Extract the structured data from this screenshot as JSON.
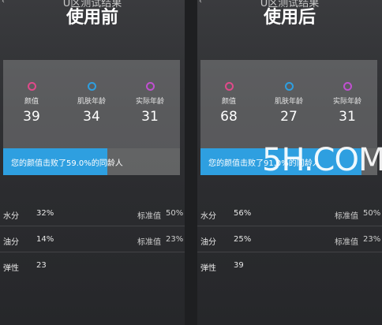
{
  "watermark": "5H.COM",
  "colors": {
    "ring_face": "#e04a8a",
    "ring_skin": "#2e9fe0",
    "ring_real": "#c050d0",
    "bar_fill": "#2e9fe0"
  },
  "panels": [
    {
      "subtitle": "U区测试结果",
      "title": "使用前",
      "metrics": [
        {
          "label": "颜值",
          "value": "39",
          "icon": "circle-pink-icon"
        },
        {
          "label": "肌肤年龄",
          "value": "34",
          "icon": "circle-blue-icon"
        },
        {
          "label": "实际年龄",
          "value": "31",
          "icon": "circle-purple-icon"
        }
      ],
      "bar_text": "您的颜值击败了59.0%的同龄人",
      "bar_percent": 59,
      "rows": [
        {
          "key": "水分",
          "value": "32%",
          "std_label": "标准值",
          "std_value": "50%"
        },
        {
          "key": "油分",
          "value": "14%",
          "std_label": "标准值",
          "std_value": "23%"
        },
        {
          "key": "弹性",
          "value": "23",
          "std_label": "",
          "std_value": ""
        }
      ]
    },
    {
      "subtitle": "U区测试结果",
      "title": "使用后",
      "metrics": [
        {
          "label": "颜值",
          "value": "68",
          "icon": "circle-pink-icon"
        },
        {
          "label": "肌肤年龄",
          "value": "27",
          "icon": "circle-blue-icon"
        },
        {
          "label": "实际年龄",
          "value": "31",
          "icon": "circle-purple-icon"
        }
      ],
      "bar_text": "您的颜值击败了91.0%的同龄人",
      "bar_percent": 91,
      "rows": [
        {
          "key": "水分",
          "value": "56%",
          "std_label": "标准值",
          "std_value": "50%"
        },
        {
          "key": "油分",
          "value": "25%",
          "std_label": "标准值",
          "std_value": "23%"
        },
        {
          "key": "弹性",
          "value": "39",
          "std_label": "",
          "std_value": ""
        }
      ]
    }
  ]
}
